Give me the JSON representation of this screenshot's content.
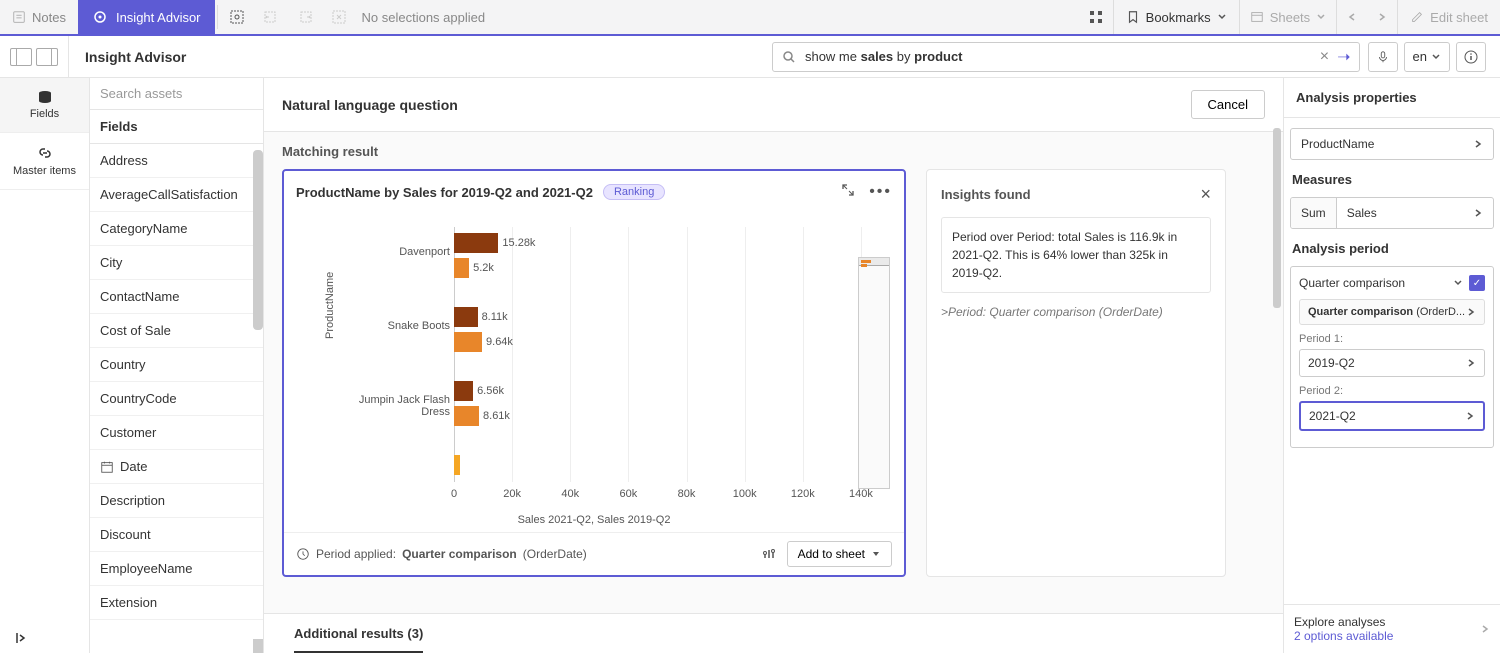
{
  "topbar": {
    "notes": "Notes",
    "insight_advisor": "Insight Advisor",
    "no_selections": "No selections applied",
    "bookmarks": "Bookmarks",
    "sheets": "Sheets",
    "edit_sheet": "Edit sheet"
  },
  "header": {
    "title": "Insight Advisor",
    "search_prefix": "show me ",
    "search_bold1": "sales",
    "search_mid": " by ",
    "search_bold2": "product",
    "lang": "en"
  },
  "rail": {
    "fields": "Fields",
    "master": "Master items"
  },
  "fields": {
    "search_placeholder": "Search assets",
    "header": "Fields",
    "items": [
      "Address",
      "AverageCallSatisfaction",
      "CategoryName",
      "City",
      "ContactName",
      "Cost of Sale",
      "Country",
      "CountryCode",
      "Customer",
      "Date",
      "Description",
      "Discount",
      "EmployeeName",
      "Extension"
    ]
  },
  "center": {
    "nl_title": "Natural language question",
    "cancel": "Cancel",
    "matching": "Matching result",
    "additional": "Additional results (3)"
  },
  "card": {
    "title": "ProductName by Sales for 2019-Q2 and 2021-Q2",
    "tag": "Ranking",
    "period_label": "Period applied:",
    "period_value": "Quarter comparison",
    "period_paren": "(OrderDate)",
    "add_to_sheet": "Add to sheet"
  },
  "insights": {
    "title": "Insights found",
    "text": "Period over Period: total Sales is 116.9k in 2021-Q2. This is 64% lower than 325k in 2019-Q2.",
    "note": ">Period: Quarter comparison (OrderDate)"
  },
  "right": {
    "title": "Analysis properties",
    "dim": "ProductName",
    "measures_label": "Measures",
    "meas_agg": "Sum",
    "meas_field": "Sales",
    "analysis_period_label": "Analysis period",
    "qc": "Quarter comparison",
    "qc_paren": "(OrderD...",
    "p1_label": "Period 1:",
    "p1_value": "2019-Q2",
    "p2_label": "Period 2:",
    "p2_value": "2021-Q2",
    "explore": "Explore analyses",
    "explore_link": "2 options available"
  },
  "chart_data": {
    "type": "bar",
    "title": "ProductName by Sales for 2019-Q2 and 2021-Q2",
    "xlabel": "Sales 2021-Q2, Sales 2019-Q2",
    "ylabel": "ProductName",
    "xlim": [
      0,
      150000
    ],
    "tick_labels": [
      "0",
      "20k",
      "40k",
      "60k",
      "80k",
      "100k",
      "120k",
      "140k"
    ],
    "categories": [
      "Davenport",
      "Snake Boots",
      "Jumpin Jack Flash Dress"
    ],
    "series": [
      {
        "name": "Sales 2019-Q2",
        "color": "#8b3a0e",
        "values": [
          15280,
          8110,
          6560
        ]
      },
      {
        "name": "Sales 2021-Q2",
        "color": "#e8862a",
        "values": [
          5200,
          9640,
          8610
        ]
      }
    ],
    "value_labels": [
      [
        "15.28k",
        "5.2k"
      ],
      [
        "8.11k",
        "9.64k"
      ],
      [
        "6.56k",
        "8.61k"
      ]
    ],
    "extra_bar": {
      "color": "#f5a623",
      "value": 2000
    }
  }
}
